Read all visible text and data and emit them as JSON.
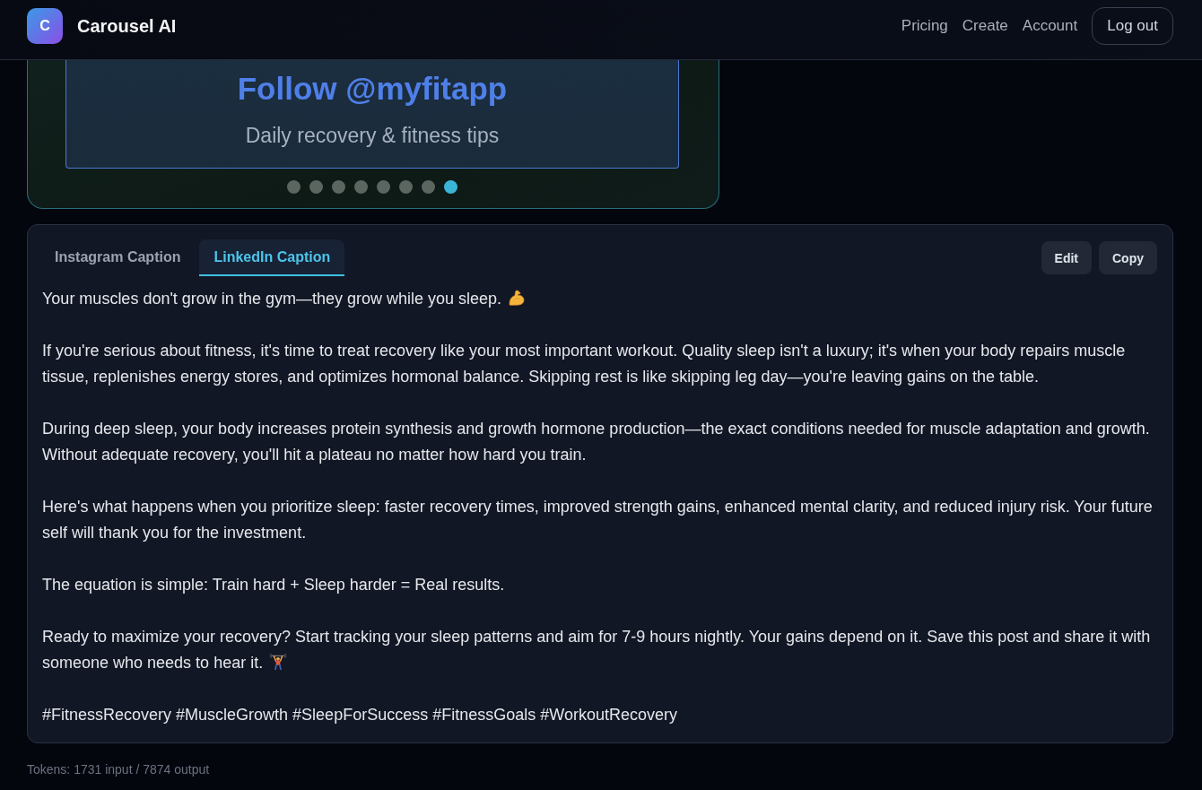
{
  "header": {
    "logo": {
      "letter": "C"
    },
    "brand": "Carousel AI",
    "nav": [
      "Pricing",
      "Create",
      "Account"
    ],
    "logout_button": "Log out"
  },
  "carousel": {
    "slide": {
      "title": "Follow @myfitapp",
      "subtitle": "Daily recovery & fitness tips"
    },
    "dots": [
      {
        "selected": false
      },
      {
        "selected": false
      },
      {
        "selected": false
      },
      {
        "selected": false
      },
      {
        "selected": false
      },
      {
        "selected": false
      },
      {
        "selected": false
      },
      {
        "selected": true
      }
    ]
  },
  "caption_panel": {
    "tabs": [
      {
        "label": "Instagram Caption",
        "selected": false
      },
      {
        "label": "LinkedIn Caption",
        "selected": true
      }
    ],
    "actions": [
      "Edit",
      "Copy"
    ],
    "paragraphs": [
      {
        "text": "Your muscles don't grow in the gym—they grow while you sleep.",
        "emoji": true
      },
      {
        "text": "If you're serious about fitness, it's time to treat recovery like your most important workout. Quality sleep isn't a luxury; it's when your body repairs muscle tissue, replenishes energy stores, and optimizes hormonal balance. Skipping rest is like skipping leg day—you're leaving gains on the table.",
        "emoji": false
      },
      {
        "text": "During deep sleep, your body increases protein synthesis and growth hormone production—the exact conditions needed for muscle adaptation and growth. Without adequate recovery, you'll hit a plateau no matter how hard you train.",
        "emoji": false
      },
      {
        "text": "Here's what happens when you prioritize sleep: faster recovery times, improved strength gains, enhanced mental clarity, and reduced injury risk. Your future self will thank you for the investment.",
        "emoji": false
      },
      {
        "text": "The equation is simple: Train hard + Sleep harder = Real results.",
        "emoji": false
      },
      {
        "text": "Ready to maximize your recovery? Start tracking your sleep patterns and aim for 7-9 hours nightly. Your gains depend on it. Save this post and share it with someone who needs to hear it.",
        "emoji": true
      },
      {
        "text": "#FitnessRecovery #MuscleGrowth #SleepForSuccess #FitnessGoals #WorkoutRecovery",
        "emoji": false
      }
    ]
  },
  "tokens": "Tokens: 1731 input / 7874 output"
}
